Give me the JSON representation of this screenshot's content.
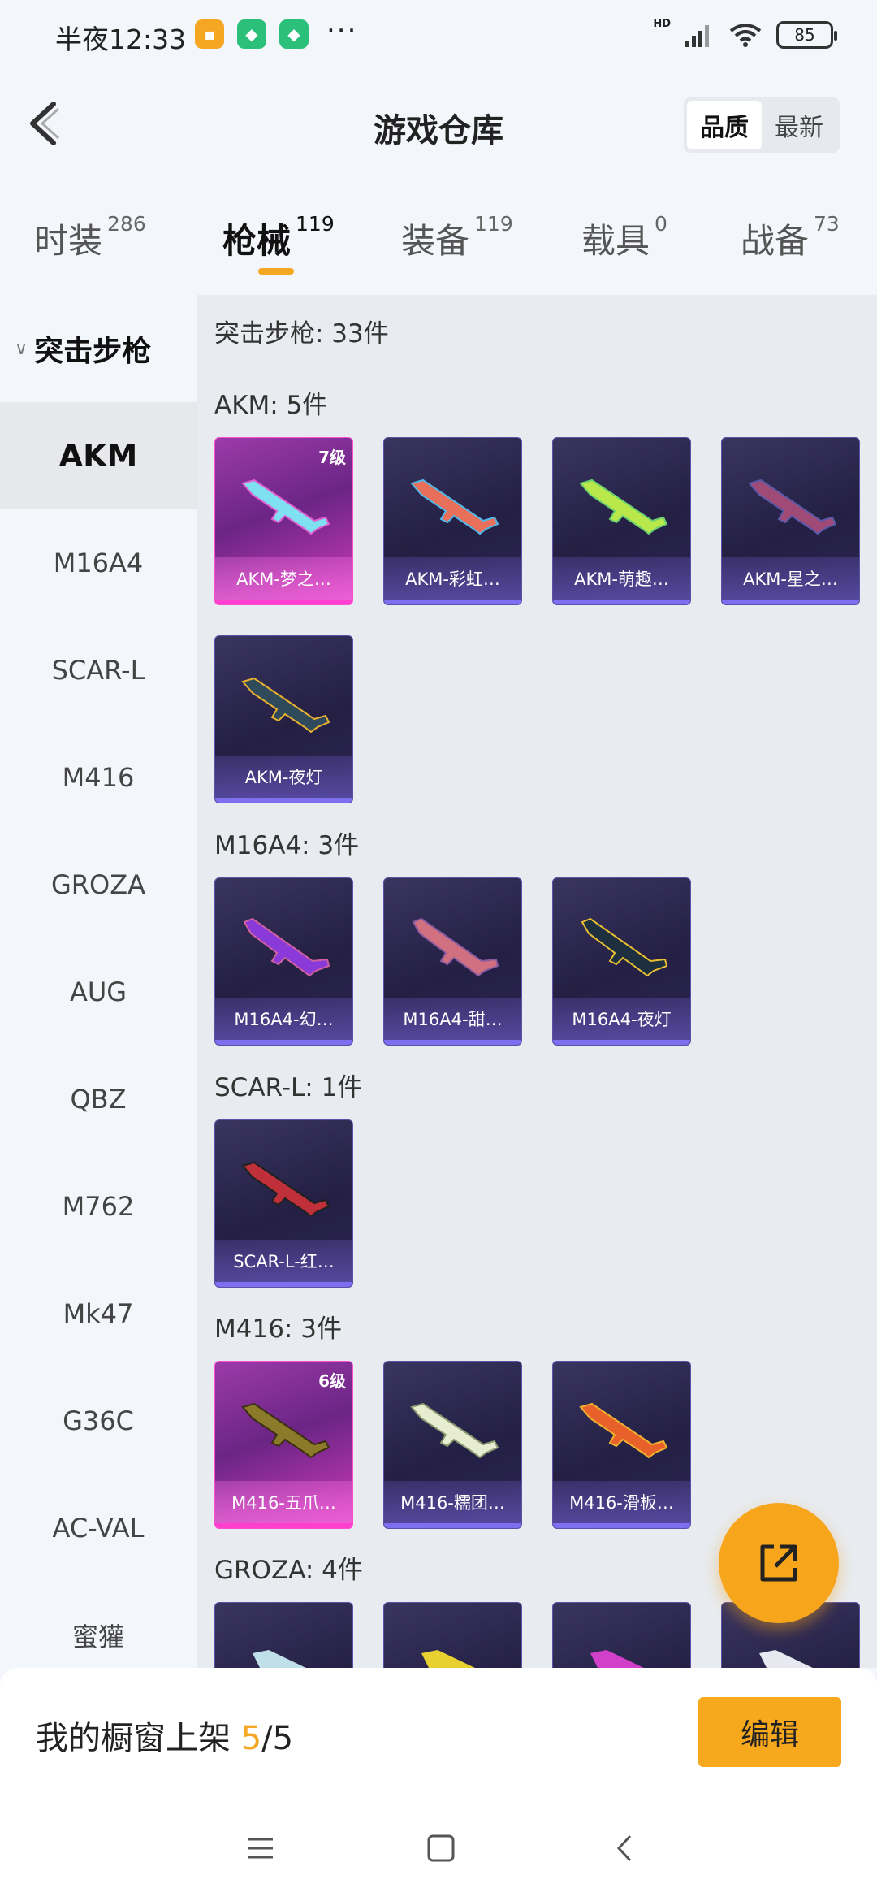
{
  "status_bar": {
    "time": "半夜12:33",
    "dots": "···",
    "hd": "HD",
    "battery": "85"
  },
  "header": {
    "title": "游戏仓库",
    "sort_options": [
      "品质",
      "最新"
    ],
    "sort_active": "品质"
  },
  "tabs": [
    {
      "label": "时装",
      "count": "286"
    },
    {
      "label": "枪械",
      "count": "119"
    },
    {
      "label": "装备",
      "count": "119"
    },
    {
      "label": "载具",
      "count": "0"
    },
    {
      "label": "战备",
      "count": "73"
    }
  ],
  "sidebar": {
    "category": "突击步枪",
    "items": [
      "AKM",
      "M16A4",
      "SCAR-L",
      "M416",
      "GROZA",
      "AUG",
      "QBZ",
      "M762",
      "Mk47",
      "G36C",
      "AC-VAL",
      "蜜獾"
    ]
  },
  "content": {
    "summary": "突击步枪: 33件",
    "groups": [
      {
        "title": "AKM: 5件",
        "cards": [
          {
            "name": "AKM-梦之…",
            "level": "7级"
          },
          {
            "name": "AKM-彩虹…"
          },
          {
            "name": "AKM-萌趣…"
          },
          {
            "name": "AKM-星之…"
          },
          {
            "name": "AKM-夜灯"
          }
        ]
      },
      {
        "title": "M16A4: 3件",
        "cards": [
          {
            "name": "M16A4-幻…"
          },
          {
            "name": "M16A4-甜…"
          },
          {
            "name": "M16A4-夜灯"
          }
        ]
      },
      {
        "title": "SCAR-L: 1件",
        "cards": [
          {
            "name": "SCAR-L-红…"
          }
        ]
      },
      {
        "title": "M416: 3件",
        "cards": [
          {
            "name": "M416-五爪…",
            "level": "6级"
          },
          {
            "name": "M416-糯团…"
          },
          {
            "name": "M416-滑板…"
          }
        ]
      },
      {
        "title": "GROZA: 4件"
      }
    ]
  },
  "bottom": {
    "showcase_label": "我的橱窗上架 ",
    "current": "5",
    "total": "/5",
    "edit_button": "编辑"
  },
  "colors": {
    "accent": "#f5a623",
    "card_pink": "#d23bbd",
    "card_purple": "#2c2652"
  },
  "icons": [
    "back-arrow-icon",
    "share-icon",
    "menu-icon",
    "home-icon",
    "back-icon"
  ]
}
